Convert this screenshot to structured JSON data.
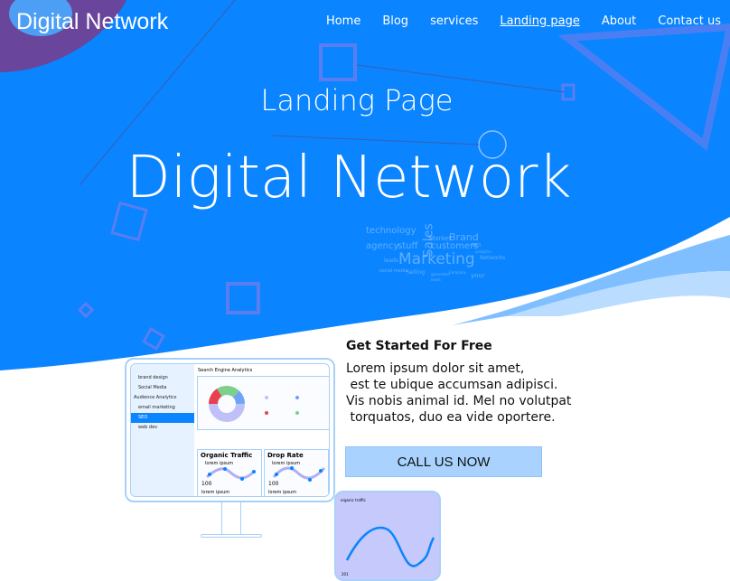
{
  "brand": "Digital Network",
  "nav": [
    {
      "label": "Home"
    },
    {
      "label": "Blog"
    },
    {
      "label": "services"
    },
    {
      "label": "Landing page",
      "active": true
    },
    {
      "label": "About"
    },
    {
      "label": "Contact us"
    }
  ],
  "hero": {
    "subtitle": "Landing Page",
    "title": "Digital Network"
  },
  "word_cloud": [
    "technology",
    "Sales",
    "Market",
    "Brand",
    "agency",
    "stuff",
    "customers",
    "SEO",
    "analytics",
    "leads",
    "Marketing",
    "Networks",
    "social media",
    "Selling",
    "generated",
    "Company",
    "leads",
    "your"
  ],
  "promo": {
    "heading": "Get Started For Free",
    "body": "Lorem ipsum dolor sit amet,\n est te ubique accumsan adipisci.\nVis nobis animal id. Mel no volutpat\n torquatos, duo ea vide oportere.",
    "cta": "CALL US NOW"
  },
  "dashboard": {
    "menu": [
      "brand design",
      "Social Media",
      "Audience Analytics",
      "email marketing",
      "SEO",
      "web dev"
    ],
    "selected": "SEO",
    "title": "Search Engine Analytics",
    "cards": [
      {
        "title": "Organic Traffic",
        "sub": "lorem ipsum",
        "value": "100",
        "foot": "lorem ipsum"
      },
      {
        "title": "Drop Rate",
        "sub": "lorem ipsum",
        "value": "100",
        "foot": "lorem ipsum"
      }
    ]
  },
  "phone": {
    "title": "organic traffic",
    "value": "201"
  },
  "colors": {
    "primary": "#0a84ff",
    "accent": "#a9d2ff"
  }
}
